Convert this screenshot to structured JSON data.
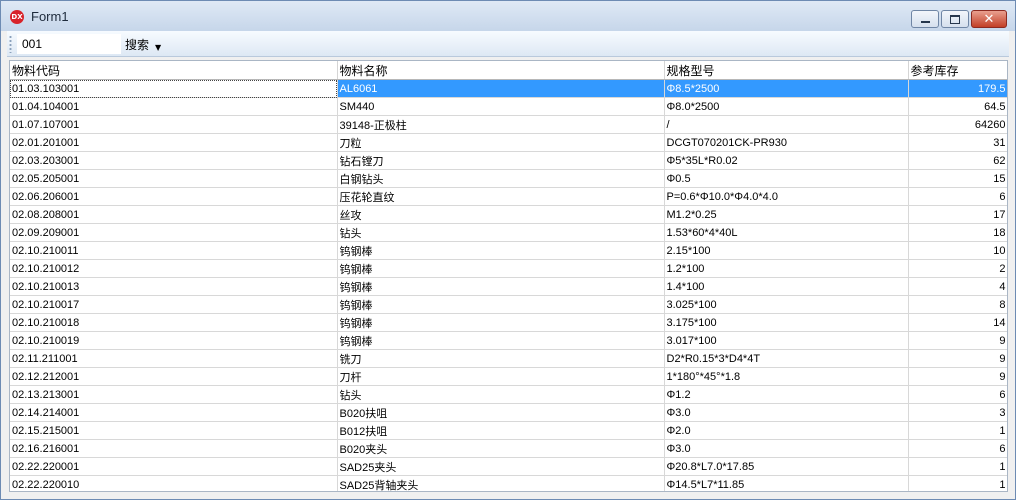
{
  "window": {
    "title": "Form1",
    "icon_label": "DX",
    "accent_color": "#3399ff"
  },
  "toolbar": {
    "search_value": "001",
    "search_label": "搜索"
  },
  "table": {
    "columns": [
      "物料代码",
      "物料名称",
      "规格型号",
      "参考库存"
    ],
    "rows": [
      [
        "01.03.103001",
        "AL6061",
        "Φ8.5*2500",
        "179.5"
      ],
      [
        "01.04.104001",
        "SM440",
        "Φ8.0*2500",
        "64.5"
      ],
      [
        "01.07.107001",
        "39148-正极柱",
        "/",
        "64260"
      ],
      [
        "02.01.201001",
        "刀粒",
        "DCGT070201CK-PR930",
        "31"
      ],
      [
        "02.03.203001",
        "钻石镗刀",
        "Φ5*35L*R0.02",
        "62"
      ],
      [
        "02.05.205001",
        "白钢钻头",
        "Φ0.5",
        "15"
      ],
      [
        "02.06.206001",
        "压花轮直纹",
        "P=0.6*Φ10.0*Φ4.0*4.0",
        "6"
      ],
      [
        "02.08.208001",
        "丝攻",
        "M1.2*0.25",
        "17"
      ],
      [
        "02.09.209001",
        "钻头",
        "1.53*60*4*40L",
        "18"
      ],
      [
        "02.10.210011",
        "钨钢棒",
        "2.15*100",
        "10"
      ],
      [
        "02.10.210012",
        "钨钢棒",
        "1.2*100",
        "2"
      ],
      [
        "02.10.210013",
        "钨钢棒",
        "1.4*100",
        "4"
      ],
      [
        "02.10.210017",
        "钨钢棒",
        "3.025*100",
        "8"
      ],
      [
        "02.10.210018",
        "钨钢棒",
        "3.175*100",
        "14"
      ],
      [
        "02.10.210019",
        "钨钢棒",
        "3.017*100",
        "9"
      ],
      [
        "02.11.211001",
        "铣刀",
        "D2*R0.15*3*D4*4T",
        "9"
      ],
      [
        "02.12.212001",
        "刀杆",
        "1*180°*45°*1.8",
        "9"
      ],
      [
        "02.13.213001",
        "钻头",
        "Φ1.2",
        "6"
      ],
      [
        "02.14.214001",
        "B020扶咀",
        "Φ3.0",
        "3"
      ],
      [
        "02.15.215001",
        "B012扶咀",
        "Φ2.0",
        "1"
      ],
      [
        "02.16.216001",
        "B020夹头",
        "Φ3.0",
        "6"
      ],
      [
        "02.22.220001",
        "SAD25夹头",
        "Φ20.8*L7.0*17.85",
        "1"
      ],
      [
        "02.22.220010",
        "SAD25背轴夹头",
        "Φ14.5*L7*11.85",
        "1"
      ]
    ]
  }
}
